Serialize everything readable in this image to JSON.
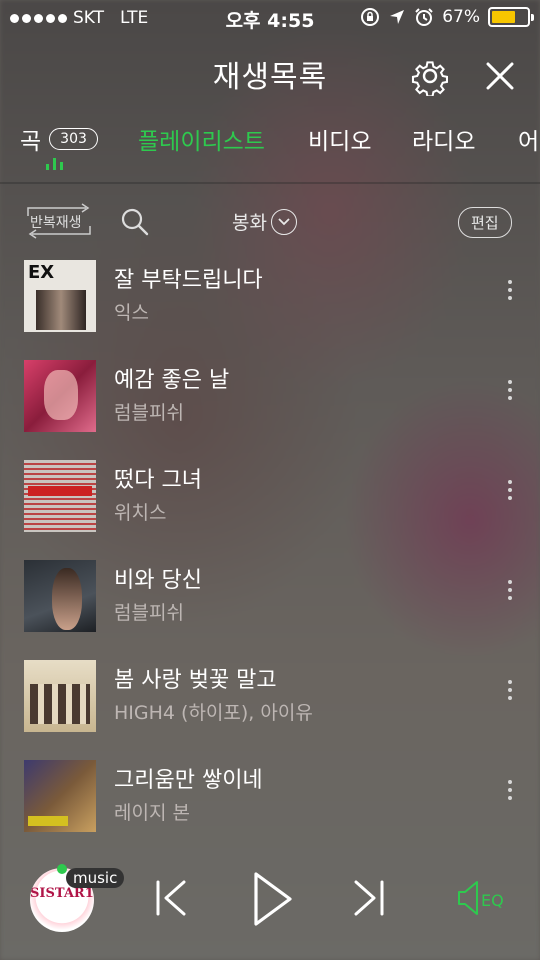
{
  "status_bar": {
    "carrier": "SKT",
    "network": "LTE",
    "time": "오후 4:55",
    "battery_percent": "67%",
    "battery_level": 0.67
  },
  "header": {
    "title": "재생목록"
  },
  "tabs": [
    {
      "label": "곡",
      "count": "303"
    },
    {
      "label": "플레이리스트"
    },
    {
      "label": "비디오"
    },
    {
      "label": "라디오"
    },
    {
      "label": "어"
    }
  ],
  "toolbar": {
    "repeat_label": "반복재생",
    "sort_label": "봉화",
    "edit_label": "편집"
  },
  "songs": [
    {
      "title": "잘 부탁드립니다",
      "artist": "익스",
      "cover_text": "EX"
    },
    {
      "title": "예감 좋은 날",
      "artist": "럼블피쉬"
    },
    {
      "title": "떴다 그녀",
      "artist": "위치스"
    },
    {
      "title": "비와 당신",
      "artist": "럼블피쉬"
    },
    {
      "title": "봄 사랑 벚꽃 말고",
      "artist": "HIGH4 (하이포), 아이유"
    },
    {
      "title": "그리움만 쌓이네",
      "artist": "레이지 본"
    }
  ],
  "player": {
    "now_playing_art_text": "SISTAR19",
    "music_badge": "music",
    "eq_label": "EQ"
  },
  "colors": {
    "accent": "#2ec94e",
    "battery": "#f7c600"
  }
}
